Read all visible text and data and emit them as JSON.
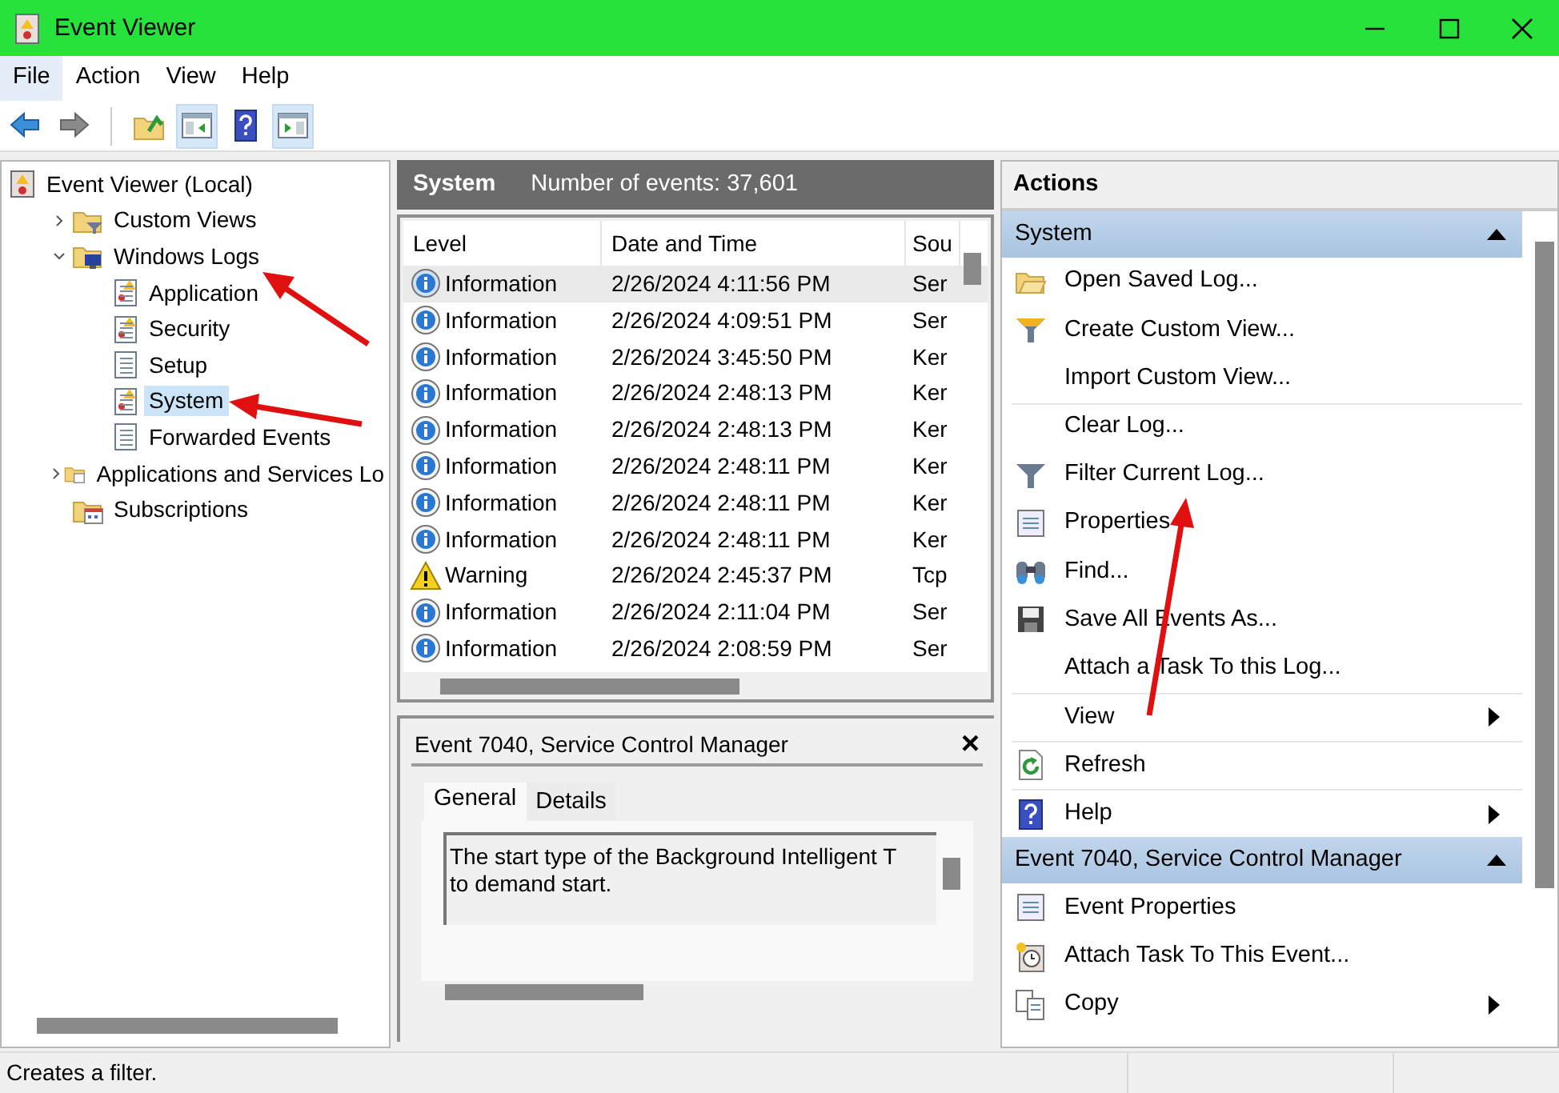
{
  "window": {
    "title": "Event Viewer"
  },
  "menu": [
    {
      "label": "File",
      "selected": true
    },
    {
      "label": "Action",
      "selected": false
    },
    {
      "label": "View",
      "selected": false
    },
    {
      "label": "Help",
      "selected": false
    }
  ],
  "toolbar": [
    {
      "kind": "back",
      "pressed": false
    },
    {
      "kind": "forward",
      "pressed": false
    },
    {
      "kind": "separator"
    },
    {
      "kind": "up",
      "pressed": false
    },
    {
      "kind": "tree-pane",
      "pressed": true
    },
    {
      "kind": "help",
      "pressed": false
    },
    {
      "kind": "action-pane",
      "pressed": true
    }
  ],
  "tree": {
    "label": "Event Viewer (Local)",
    "kind": "root",
    "selected": false,
    "children": [
      {
        "label": "Custom Views",
        "kind": "folder-filter",
        "selected": false,
        "expanded": false
      },
      {
        "label": "Windows Logs",
        "kind": "folder-logs",
        "selected": false,
        "expanded": true,
        "children": [
          {
            "label": "Application",
            "kind": "log-warn",
            "selected": false
          },
          {
            "label": "Security",
            "kind": "log-warn",
            "selected": false
          },
          {
            "label": "Setup",
            "kind": "log",
            "selected": false
          },
          {
            "label": "System",
            "kind": "log-warn",
            "selected": true
          },
          {
            "label": "Forwarded Events",
            "kind": "log",
            "selected": false
          }
        ]
      },
      {
        "label": "Applications and Services Lo",
        "kind": "folder",
        "selected": false,
        "expanded": false
      },
      {
        "label": "Subscriptions",
        "kind": "subscriptions",
        "selected": false
      }
    ]
  },
  "log_header": {
    "title": "System",
    "count": "Number of events: 37,601"
  },
  "events": {
    "columns": [
      "Level",
      "Date and Time",
      "Sou"
    ],
    "rows": [
      {
        "kind": "info",
        "selected": true,
        "cells": [
          "Information",
          "2/26/2024 4:11:56 PM",
          "Ser"
        ]
      },
      {
        "kind": "info",
        "selected": false,
        "cells": [
          "Information",
          "2/26/2024 4:09:51 PM",
          "Ser"
        ]
      },
      {
        "kind": "info",
        "selected": false,
        "cells": [
          "Information",
          "2/26/2024 3:45:50 PM",
          "Ker"
        ]
      },
      {
        "kind": "info",
        "selected": false,
        "cells": [
          "Information",
          "2/26/2024 2:48:13 PM",
          "Ker"
        ]
      },
      {
        "kind": "info",
        "selected": false,
        "cells": [
          "Information",
          "2/26/2024 2:48:13 PM",
          "Ker"
        ]
      },
      {
        "kind": "info",
        "selected": false,
        "cells": [
          "Information",
          "2/26/2024 2:48:11 PM",
          "Ker"
        ]
      },
      {
        "kind": "info",
        "selected": false,
        "cells": [
          "Information",
          "2/26/2024 2:48:11 PM",
          "Ker"
        ]
      },
      {
        "kind": "info",
        "selected": false,
        "cells": [
          "Information",
          "2/26/2024 2:48:11 PM",
          "Ker"
        ]
      },
      {
        "kind": "warning",
        "selected": false,
        "cells": [
          "Warning",
          "2/26/2024 2:45:37 PM",
          "Tcp"
        ]
      },
      {
        "kind": "info",
        "selected": false,
        "cells": [
          "Information",
          "2/26/2024 2:11:04 PM",
          "Ser"
        ]
      },
      {
        "kind": "info",
        "selected": false,
        "cells": [
          "Information",
          "2/26/2024 2:08:59 PM",
          "Ser"
        ]
      }
    ]
  },
  "detail": {
    "title": "Event 7040, Service Control Manager",
    "close": "×",
    "tabs": [
      {
        "label": "General",
        "selected": true
      },
      {
        "label": "Details",
        "selected": false
      }
    ],
    "message_lines": [
      "The start type of the Background Intelligent T",
      "to demand start."
    ]
  },
  "actions": {
    "title": "Actions",
    "sections": [
      {
        "title": "System",
        "expanded": true,
        "items": [
          {
            "label": "Open Saved Log...",
            "kind": "open",
            "submenu": false,
            "separator_before": false
          },
          {
            "label": "Create Custom View...",
            "kind": "filter-gold",
            "submenu": false,
            "separator_before": false
          },
          {
            "label": "Import Custom View...",
            "kind": "plain",
            "submenu": false,
            "separator_before": false
          },
          {
            "label": "Clear Log...",
            "kind": "plain",
            "submenu": false,
            "separator_before": true
          },
          {
            "label": "Filter Current Log...",
            "kind": "filter",
            "submenu": false,
            "separator_before": false
          },
          {
            "label": "Properties",
            "kind": "properties",
            "submenu": false,
            "separator_before": false
          },
          {
            "label": "Find...",
            "kind": "find",
            "submenu": false,
            "separator_before": false
          },
          {
            "label": "Save All Events As...",
            "kind": "save",
            "submenu": false,
            "separator_before": false
          },
          {
            "label": "Attach a Task To this Log...",
            "kind": "plain",
            "submenu": false,
            "separator_before": false
          },
          {
            "label": "View",
            "kind": "plain",
            "submenu": true,
            "separator_before": true
          },
          {
            "label": "Refresh",
            "kind": "refresh",
            "submenu": false,
            "separator_before": true
          },
          {
            "label": "Help",
            "kind": "help",
            "submenu": true,
            "separator_before": true
          }
        ]
      },
      {
        "title": "Event 7040, Service Control Manager",
        "expanded": true,
        "items": [
          {
            "label": "Event Properties",
            "kind": "properties",
            "submenu": false,
            "separator_before": false
          },
          {
            "label": "Attach Task To This Event...",
            "kind": "task",
            "submenu": false,
            "separator_before": false
          },
          {
            "label": "Copy",
            "kind": "copy",
            "submenu": true,
            "separator_before": false
          }
        ]
      }
    ]
  },
  "status_bar": "Creates a filter."
}
